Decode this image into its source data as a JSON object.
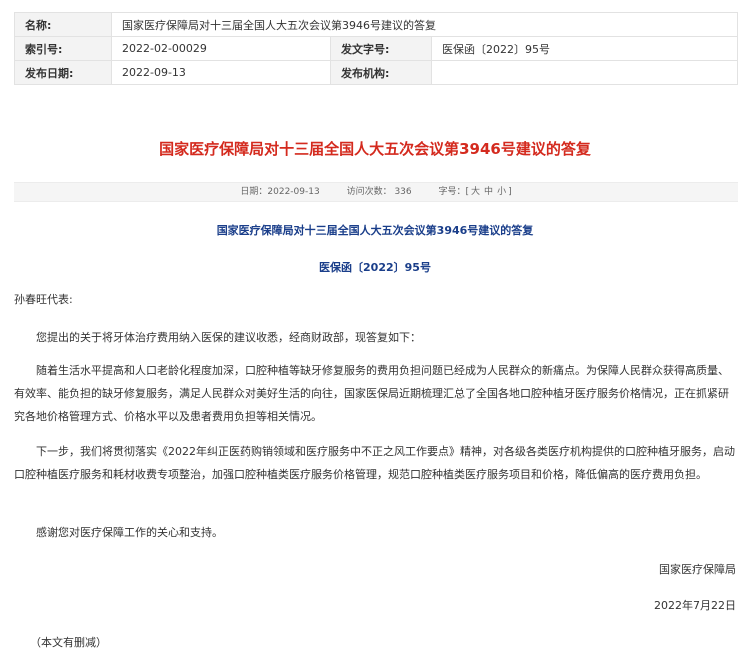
{
  "meta": {
    "name_label": "名称:",
    "name_value": "国家医疗保障局对十三届全国人大五次会议第3946号建议的答复",
    "index_label": "索引号:",
    "index_value": "2022-02-00029",
    "docno_label": "发文字号:",
    "docno_value": "医保函〔2022〕95号",
    "date_label": "发布日期:",
    "date_value": "2022-09-13",
    "org_label": "发布机构:",
    "org_value": ""
  },
  "title": "国家医疗保障局对十三届全国人大五次会议第3946号建议的答复",
  "infobar": {
    "date": "日期：2022-09-13",
    "visits": "访问次数： 336",
    "fontsize_label": "字号：[",
    "font_big": "大",
    "font_mid": "中",
    "font_small": "小",
    "fontsize_end": "]"
  },
  "subtitle": "国家医疗保障局对十三届全国人大五次会议第3946号建议的答复",
  "docno": "医保函〔2022〕95号",
  "body": {
    "salutation": "孙春旺代表:",
    "p1": "您提出的关于将牙体治疗费用纳入医保的建议收悉，经商财政部，现答复如下：",
    "p2": "随着生活水平提高和人口老龄化程度加深，口腔种植等缺牙修复服务的费用负担问题已经成为人民群众的新痛点。为保障人民群众获得高质量、有效率、能负担的缺牙修复服务，满足人民群众对美好生活的向往，国家医保局近期梳理汇总了全国各地口腔种植牙医疗服务价格情况，正在抓紧研究各地价格管理方式、价格水平以及患者费用负担等相关情况。",
    "p3": "下一步，我们将贯彻落实《2022年纠正医药购销领域和医疗服务中不正之风工作要点》精神，对各级各类医疗机构提供的口腔种植牙服务，启动口腔种植医疗服务和耗材收费专项整治，加强口腔种植类医疗服务价格管理，规范口腔种植类医疗服务项目和价格，降低偏高的医疗费用负担。",
    "p4": "感谢您对医疗保障工作的关心和支持。",
    "signature": "国家医疗保障局",
    "sign_date": "2022年7月22日",
    "note": "（本文有删减）"
  }
}
